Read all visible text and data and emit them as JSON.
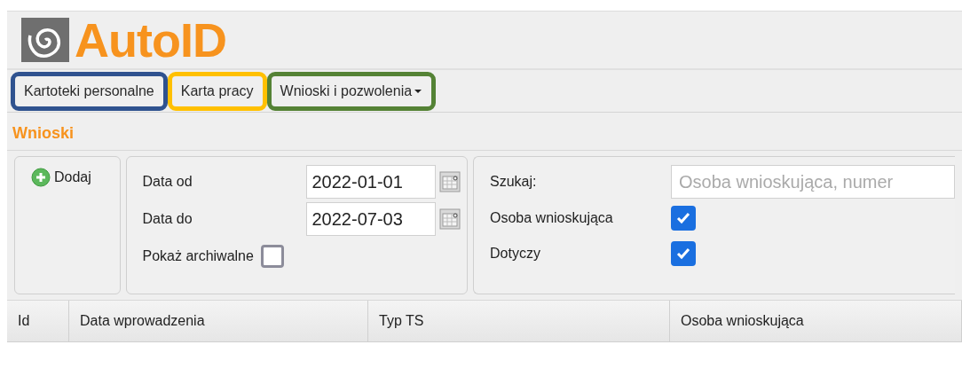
{
  "logo": {
    "text": "AutoID"
  },
  "menu": [
    {
      "label": "Kartoteki personalne",
      "color": "#2f528f",
      "dropdown": false
    },
    {
      "label": "Karta pracy",
      "color": "#ffc000",
      "dropdown": false
    },
    {
      "label": "Wnioski i pozwolenia",
      "color": "#548235",
      "dropdown": true
    }
  ],
  "page_title": "Wnioski",
  "add_button": {
    "label": "Dodaj"
  },
  "date_filters": [
    {
      "label": "Data od",
      "value": "2022-01-01"
    },
    {
      "label": "Data do",
      "value": "2022-07-03"
    }
  ],
  "show_archived": {
    "label": "Pokaż archiwalne",
    "checked": false
  },
  "search": {
    "label": "Szukaj:",
    "placeholder": "Osoba wnioskująca, numer"
  },
  "search_options": [
    {
      "label": "Osoba wnioskująca",
      "checked": true
    },
    {
      "label": "Dotyczy",
      "checked": true
    }
  ],
  "table": {
    "columns": [
      "Id",
      "Data wprowadzenia",
      "Typ TS",
      "Osoba wnioskująca"
    ]
  }
}
